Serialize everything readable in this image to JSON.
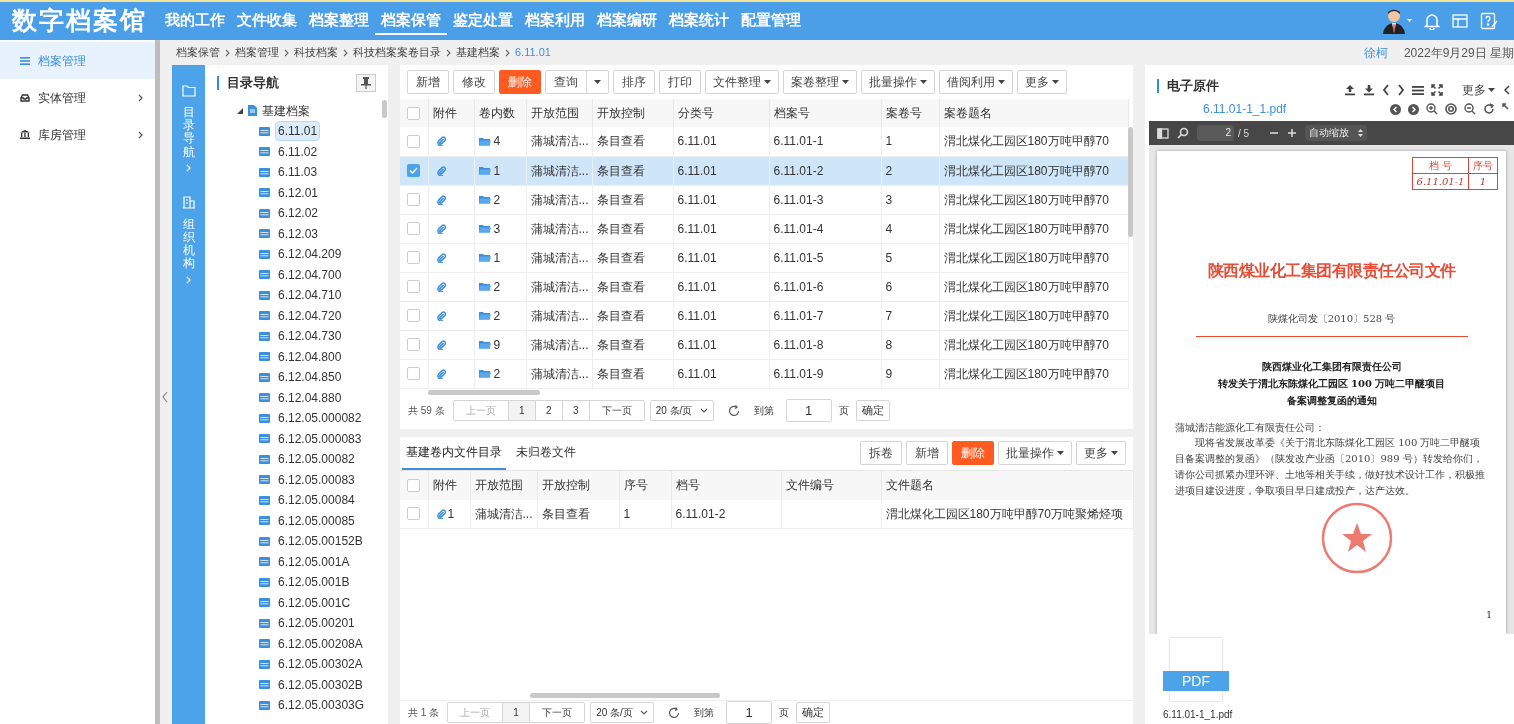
{
  "header": {
    "logo": "数字档案馆",
    "nav": [
      {
        "label": "我的工作",
        "selected": false
      },
      {
        "label": "文件收集",
        "selected": false
      },
      {
        "label": "档案整理",
        "selected": false
      },
      {
        "label": "档案保管",
        "selected": true
      },
      {
        "label": "鉴定处置",
        "selected": false
      },
      {
        "label": "档案利用",
        "selected": false
      },
      {
        "label": "档案编研",
        "selected": false
      },
      {
        "label": "档案统计",
        "selected": false
      },
      {
        "label": "配置管理",
        "selected": false
      }
    ]
  },
  "sidebar": {
    "items": [
      {
        "label": "档案管理",
        "selected": true,
        "expandable": false
      },
      {
        "label": "实体管理",
        "selected": false,
        "expandable": true
      },
      {
        "label": "库房管理",
        "selected": false,
        "expandable": true
      }
    ]
  },
  "breadcrumb": {
    "items": [
      "档案保管",
      "档案管理",
      "科技档案",
      "科技档案案卷目录",
      "基建档案",
      "6.11.01"
    ],
    "user": "徐柯",
    "date": "2022年9月29日 星期"
  },
  "side_strip": {
    "items": [
      {
        "kind": "folder",
        "label": "目录导航"
      },
      {
        "kind": "org",
        "label": "组织机构"
      }
    ]
  },
  "tree": {
    "title": "目录导航",
    "root": {
      "label": "基建档案",
      "expanded": true,
      "children": [
        {
          "label": "6.11.01",
          "selected": true
        },
        {
          "label": "6.11.02",
          "selected": false
        },
        {
          "label": "6.11.03",
          "selected": false
        },
        {
          "label": "6.12.01",
          "selected": false
        },
        {
          "label": "6.12.02",
          "selected": false
        },
        {
          "label": "6.12.03",
          "selected": false
        },
        {
          "label": "6.12.04.209",
          "selected": false
        },
        {
          "label": "6.12.04.700",
          "selected": false
        },
        {
          "label": "6.12.04.710",
          "selected": false
        },
        {
          "label": "6.12.04.720",
          "selected": false
        },
        {
          "label": "6.12.04.730",
          "selected": false
        },
        {
          "label": "6.12.04.800",
          "selected": false
        },
        {
          "label": "6.12.04.850",
          "selected": false
        },
        {
          "label": "6.12.04.880",
          "selected": false
        },
        {
          "label": "6.12.05.000082",
          "selected": false
        },
        {
          "label": "6.12.05.000083",
          "selected": false
        },
        {
          "label": "6.12.05.00082",
          "selected": false
        },
        {
          "label": "6.12.05.00083",
          "selected": false
        },
        {
          "label": "6.12.05.00084",
          "selected": false
        },
        {
          "label": "6.12.05.00085",
          "selected": false
        },
        {
          "label": "6.12.05.00152B",
          "selected": false
        },
        {
          "label": "6.12.05.001A",
          "selected": false
        },
        {
          "label": "6.12.05.001B",
          "selected": false
        },
        {
          "label": "6.12.05.001C",
          "selected": false
        },
        {
          "label": "6.12.05.00201",
          "selected": false
        },
        {
          "label": "6.12.05.00208A",
          "selected": false
        },
        {
          "label": "6.12.05.00302A",
          "selected": false
        },
        {
          "label": "6.12.05.00302B",
          "selected": false
        },
        {
          "label": "6.12.05.00303G",
          "selected": false
        }
      ]
    }
  },
  "volume_table": {
    "toolbar": [
      {
        "label": "新增",
        "kind": "button"
      },
      {
        "label": "修改",
        "kind": "button"
      },
      {
        "label": "删除",
        "kind": "danger"
      },
      {
        "label": "查询",
        "kind": "split"
      },
      {
        "label": "排序",
        "kind": "button"
      },
      {
        "label": "打印",
        "kind": "button"
      },
      {
        "label": "文件整理",
        "kind": "menu"
      },
      {
        "label": "案卷整理",
        "kind": "menu"
      },
      {
        "label": "批量操作",
        "kind": "menu"
      },
      {
        "label": "借阅利用",
        "kind": "menu"
      },
      {
        "label": "更多",
        "kind": "menu"
      }
    ],
    "select_all": false,
    "columns": [
      "附件",
      "卷内数",
      "开放范围",
      "开放控制",
      "分类号",
      "档案号",
      "案卷号",
      "案卷题名"
    ],
    "rows": [
      {
        "selected": false,
        "volume_count": "4",
        "open_scope": "蒲城清洁...",
        "open_control": "条目查看",
        "class_no": "6.11.01",
        "archive_no": "6.11.01-1",
        "volume_no": "1",
        "title": "渭北煤化工园区180万吨甲醇70"
      },
      {
        "selected": true,
        "volume_count": "1",
        "open_scope": "蒲城清洁...",
        "open_control": "条目查看",
        "class_no": "6.11.01",
        "archive_no": "6.11.01-2",
        "volume_no": "2",
        "title": "渭北煤化工园区180万吨甲醇70"
      },
      {
        "selected": false,
        "volume_count": "2",
        "open_scope": "蒲城清洁...",
        "open_control": "条目查看",
        "class_no": "6.11.01",
        "archive_no": "6.11.01-3",
        "volume_no": "3",
        "title": "渭北煤化工园区180万吨甲醇70"
      },
      {
        "selected": false,
        "volume_count": "3",
        "open_scope": "蒲城清洁...",
        "open_control": "条目查看",
        "class_no": "6.11.01",
        "archive_no": "6.11.01-4",
        "volume_no": "4",
        "title": "渭北煤化工园区180万吨甲醇70"
      },
      {
        "selected": false,
        "volume_count": "1",
        "open_scope": "蒲城清洁...",
        "open_control": "条目查看",
        "class_no": "6.11.01",
        "archive_no": "6.11.01-5",
        "volume_no": "5",
        "title": "渭北煤化工园区180万吨甲醇70"
      },
      {
        "selected": false,
        "volume_count": "2",
        "open_scope": "蒲城清洁...",
        "open_control": "条目查看",
        "class_no": "6.11.01",
        "archive_no": "6.11.01-6",
        "volume_no": "6",
        "title": "渭北煤化工园区180万吨甲醇70"
      },
      {
        "selected": false,
        "volume_count": "2",
        "open_scope": "蒲城清洁...",
        "open_control": "条目查看",
        "class_no": "6.11.01",
        "archive_no": "6.11.01-7",
        "volume_no": "7",
        "title": "渭北煤化工园区180万吨甲醇70"
      },
      {
        "selected": false,
        "volume_count": "9",
        "open_scope": "蒲城清洁...",
        "open_control": "条目查看",
        "class_no": "6.11.01",
        "archive_no": "6.11.01-8",
        "volume_no": "8",
        "title": "渭北煤化工园区180万吨甲醇70"
      },
      {
        "selected": false,
        "volume_count": "2",
        "open_scope": "蒲城清洁...",
        "open_control": "条目查看",
        "class_no": "6.11.01",
        "archive_no": "6.11.01-9",
        "volume_no": "9",
        "title": "渭北煤化工园区180万吨甲醇70"
      }
    ],
    "pagination": {
      "total": "共 59 条",
      "prev": "上一页",
      "pages": [
        {
          "label": "1",
          "selected": true
        },
        {
          "label": "2",
          "selected": false
        },
        {
          "label": "3",
          "selected": false
        }
      ],
      "next": "下一页",
      "page_size": "20 条/页",
      "goto_label": "到第",
      "goto_value": "1",
      "unit": "页",
      "confirm": "确定"
    }
  },
  "file_table": {
    "tabs": [
      {
        "label": "基建卷内文件目录",
        "selected": true
      },
      {
        "label": "未归卷文件",
        "selected": false
      }
    ],
    "toolbar": [
      {
        "label": "拆卷",
        "kind": "button"
      },
      {
        "label": "新增",
        "kind": "button"
      },
      {
        "label": "删除",
        "kind": "danger"
      },
      {
        "label": "批量操作",
        "kind": "menu"
      },
      {
        "label": "更多",
        "kind": "menu"
      }
    ],
    "select_all": false,
    "columns": [
      "附件",
      "开放范围",
      "开放控制",
      "序号",
      "档号",
      "文件编号",
      "文件题名"
    ],
    "rows": [
      {
        "selected": false,
        "attachment_count": "1",
        "open_scope": "蒲城清洁...",
        "open_control": "条目查看",
        "seq": "1",
        "archive_no": "6.11.01-2",
        "title": "渭北煤化工园区180万吨甲醇70万吨聚烯烃项"
      }
    ],
    "pagination": {
      "total": "共 1 条",
      "prev": "上一页",
      "pages": [
        {
          "label": "1",
          "selected": true
        }
      ],
      "next": "下一页",
      "page_size": "20 条/页",
      "goto_label": "到第",
      "goto_value": "1",
      "unit": "页",
      "confirm": "确定"
    }
  },
  "viewer": {
    "title": "电子原件",
    "more": "更多",
    "file_name": "6.11.01-1_1.pdf",
    "pdf_toolbar": {
      "page": "2",
      "total": "/ 5",
      "zoom": "自动缩放"
    },
    "document": {
      "stamp": {
        "labels": [
          "档 号",
          "序号"
        ],
        "values": [
          "6.11.01-1",
          "1"
        ]
      },
      "title": "陕西煤业化工集团有限责任公司文件",
      "doc_number": "陕煤化司发〔2010〕528 号",
      "heading": [
        "陕西煤业化工集团有限责任公司",
        "转发关于渭北东陈煤化工园区 100 万吨二甲醚项目",
        "备案调整复函的通知"
      ],
      "salutation": "蒲城清洁能源化工有限责任公司：",
      "body": "现将省发展改革委《关于渭北东陈煤化工园区 100 万吨二甲醚项目备案调整的复函》（陕发改产业函〔2010〕989 号）转发给你们，请你公司抓紧办理环评、土地等相关手续，做好技术设计工作，积极推进项目建设进度，争取项目早日建成投产，达产达效。",
      "page_number": "1"
    },
    "attachment": {
      "badge": "PDF",
      "file_name": "6.11.01-1_1.pdf"
    }
  }
}
